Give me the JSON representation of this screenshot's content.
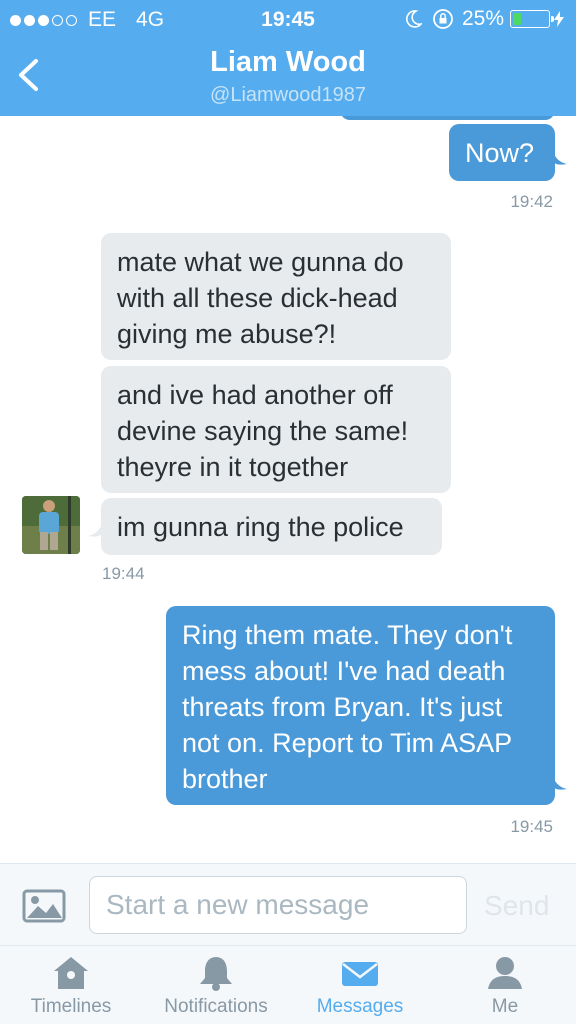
{
  "status_bar": {
    "carrier": "EE",
    "network": "4G",
    "time": "19:45",
    "battery": "25%",
    "battery_level": 0.25
  },
  "header": {
    "title": "Liam Wood",
    "handle": "@Liamwood1987"
  },
  "messages": [
    {
      "direction": "out",
      "text": "Now?"
    },
    {
      "timestamp": "19:42"
    },
    {
      "direction": "in",
      "text": "mate what we gunna do with all these dick-head giving me abuse?!"
    },
    {
      "direction": "in",
      "text": "and ive had another off devine saying the same! theyre in it together"
    },
    {
      "direction": "in",
      "text": "im gunna ring the police"
    },
    {
      "timestamp": "19:44"
    },
    {
      "direction": "out",
      "text": "Ring them mate. They don't mess about! I've had death threats from Bryan. It's just not on. Report to Tim ASAP brother"
    },
    {
      "timestamp": "19:45"
    }
  ],
  "composer": {
    "placeholder": "Start a new message",
    "send_label": "Send"
  },
  "tabs": [
    {
      "label": "Timelines",
      "icon": "home-icon"
    },
    {
      "label": "Notifications",
      "icon": "bell-icon"
    },
    {
      "label": "Messages",
      "icon": "envelope-icon",
      "active": true
    },
    {
      "label": "Me",
      "icon": "person-icon"
    }
  ],
  "colors": {
    "brand": "#55acee",
    "outgoing_bubble": "#4a99d9",
    "incoming_bubble": "#e7ebee",
    "timestamp": "#8899a6"
  }
}
